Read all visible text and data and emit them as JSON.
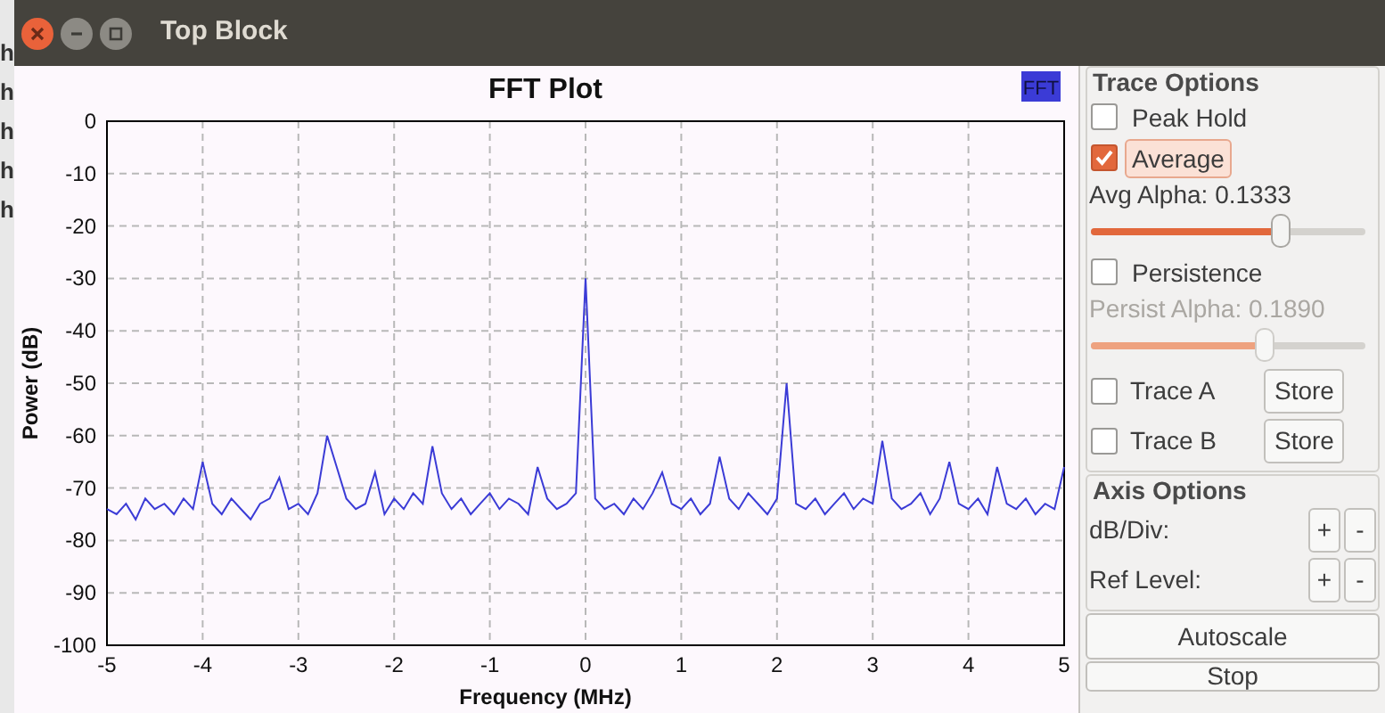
{
  "background_window": {
    "texts": [
      "h",
      "h",
      "h",
      "h",
      "h"
    ]
  },
  "window": {
    "title": "Top Block"
  },
  "plot": {
    "chart_data": {
      "type": "line",
      "grid": true,
      "title": "FFT Plot",
      "xlabel": "Frequency (MHz)",
      "ylabel": "Power (dB)",
      "xlim": [
        -5,
        5
      ],
      "ylim": [
        -100,
        0
      ],
      "xticks": [
        -5,
        -4,
        -3,
        -2,
        -1,
        0,
        1,
        2,
        3,
        4,
        5
      ],
      "yticks": [
        0,
        -10,
        -20,
        -30,
        -40,
        -50,
        -60,
        -70,
        -80,
        -90,
        -100
      ],
      "x": [
        -5,
        -4.9,
        -4.8,
        -4.7,
        -4.6,
        -4.5,
        -4.4,
        -4.3,
        -4.2,
        -4.1,
        -4,
        -3.9,
        -3.8,
        -3.7,
        -3.6,
        -3.5,
        -3.4,
        -3.3,
        -3.2,
        -3.1,
        -3,
        -2.9,
        -2.8,
        -2.7,
        -2.6,
        -2.5,
        -2.4,
        -2.3,
        -2.2,
        -2.1,
        -2,
        -1.9,
        -1.8,
        -1.7,
        -1.6,
        -1.5,
        -1.4,
        -1.3,
        -1.2,
        -1.1,
        -1,
        -0.9,
        -0.8,
        -0.7,
        -0.6,
        -0.5,
        -0.4,
        -0.3,
        -0.2,
        -0.1,
        0,
        0.1,
        0.2,
        0.3,
        0.4,
        0.5,
        0.6,
        0.7,
        0.8,
        0.9,
        1,
        1.1,
        1.2,
        1.3,
        1.4,
        1.5,
        1.6,
        1.7,
        1.8,
        1.9,
        2,
        2.1,
        2.2,
        2.3,
        2.4,
        2.5,
        2.6,
        2.7,
        2.8,
        2.9,
        3,
        3.1,
        3.2,
        3.3,
        3.4,
        3.5,
        3.6,
        3.7,
        3.8,
        3.9,
        4,
        4.1,
        4.2,
        4.3,
        4.4,
        4.5,
        4.6,
        4.7,
        4.8,
        4.9,
        5
      ],
      "series": [
        {
          "name": "FFT",
          "color": "#3b3bd6",
          "values": [
            -74,
            -75,
            -73,
            -76,
            -72,
            -74,
            -73,
            -75,
            -72,
            -74,
            -65,
            -73,
            -75,
            -72,
            -74,
            -76,
            -73,
            -72,
            -68,
            -74,
            -73,
            -75,
            -71,
            -60,
            -66,
            -72,
            -74,
            -73,
            -67,
            -75,
            -72,
            -74,
            -71,
            -73,
            -62,
            -71,
            -74,
            -72,
            -75,
            -73,
            -71,
            -74,
            -72,
            -73,
            -75,
            -66,
            -72,
            -74,
            -73,
            -71,
            -30,
            -72,
            -74,
            -73,
            -75,
            -72,
            -74,
            -71,
            -67,
            -73,
            -74,
            -72,
            -75,
            -73,
            -64,
            -72,
            -74,
            -71,
            -73,
            -75,
            -72,
            -50,
            -73,
            -74,
            -72,
            -75,
            -73,
            -71,
            -74,
            -72,
            -73,
            -61,
            -72,
            -74,
            -73,
            -71,
            -75,
            -72,
            -65,
            -73,
            -74,
            -72,
            -75,
            -66,
            -73,
            -74,
            -72,
            -75,
            -73,
            -74,
            -66
          ]
        }
      ]
    }
  },
  "trace_options": {
    "title": "Trace Options",
    "items": [
      {
        "kind": "checkbox",
        "label": "Peak Hold",
        "checked": false,
        "focused": false
      },
      {
        "kind": "checkbox",
        "label": "Average",
        "checked": true,
        "focused": true
      },
      {
        "kind": "slider",
        "label": "Avg Alpha: 0.1333",
        "level": 0.69,
        "disabled": false
      },
      {
        "kind": "checkbox",
        "label": "Persistence",
        "checked": false,
        "focused": false
      },
      {
        "kind": "slider",
        "label": "Persist Alpha: 0.1890",
        "level": 0.63,
        "disabled": true
      },
      {
        "kind": "store",
        "label": "Trace A",
        "checked": false,
        "button": "Store"
      },
      {
        "kind": "store",
        "label": "Trace B",
        "checked": false,
        "button": "Store"
      }
    ]
  },
  "axis_options": {
    "title": "Axis Options",
    "items": [
      {
        "label": "dB/Div:",
        "buttons": [
          "+",
          "-"
        ]
      },
      {
        "label": "Ref Level:",
        "buttons": [
          "+",
          "-"
        ]
      }
    ]
  },
  "buttons": [
    "Autoscale",
    "Stop"
  ]
}
